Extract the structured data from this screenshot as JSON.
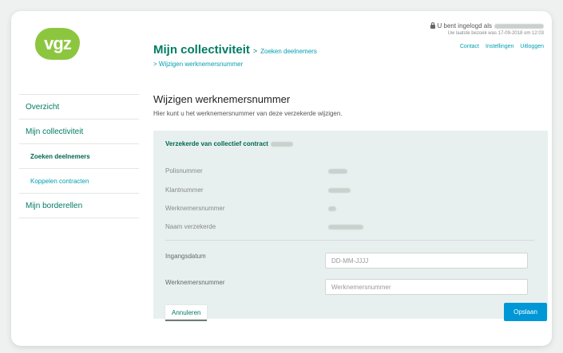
{
  "logo": {
    "text": "vgz"
  },
  "header": {
    "login_prefix": "U bent ingelogd als",
    "last_visit": "Uw laatste bezoek was 17-09-2018 om 12:03",
    "links": [
      "Contact",
      "Instellingen",
      "Uitloggen"
    ],
    "title": "Mijn collectiviteit",
    "separator": ">",
    "crumb1": "Zoeken deelnemers",
    "crumb2": "Wijzigen werknemersnummer"
  },
  "sidebar": {
    "items": [
      {
        "label": "Overzicht"
      },
      {
        "label": "Mijn collectiviteit"
      },
      {
        "label": "Zoeken deelnemers"
      },
      {
        "label": "Koppelen contracten"
      },
      {
        "label": "Mijn borderellen"
      }
    ]
  },
  "main": {
    "title": "Wijzigen werknemersnummer",
    "subtitle": "Hier kunt u het werknemersnummer van deze verzekerde wijzigen.",
    "panel_title": "Verzekerde van collectief contract",
    "info": [
      {
        "label": "Polisnummer"
      },
      {
        "label": "Klantnummer"
      },
      {
        "label": "Werknemersnummer"
      },
      {
        "label": "Naam verzekerde"
      }
    ],
    "form": {
      "date_label": "Ingangsdatum",
      "date_placeholder": "DD-MM-JJJJ",
      "number_label": "Werknemersnummer",
      "number_placeholder": "Werknemersnummer"
    },
    "cancel_label": "Annuleren",
    "save_label": "Opslaan"
  },
  "colors": {
    "brand_green": "#007c64",
    "link_teal": "#00a0b0",
    "save_blue": "#0097d7",
    "logo_green": "#8cc63f",
    "panel_bg": "#e7f0ee"
  }
}
